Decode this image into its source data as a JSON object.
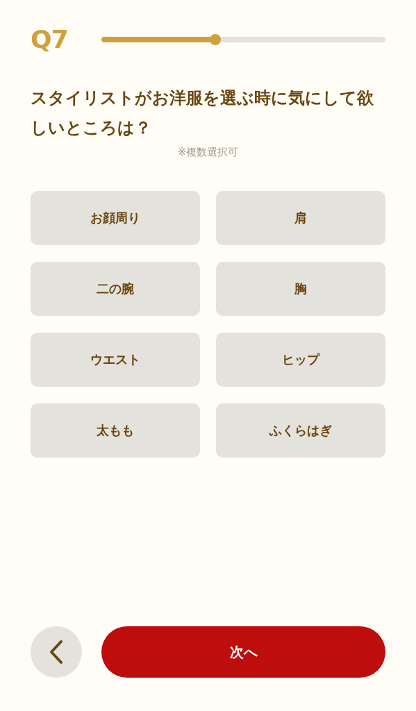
{
  "header": {
    "question_number": "Q7",
    "progress": {
      "level": 0.4
    }
  },
  "question": {
    "title": "スタイリストがお洋服を選ぶ時に気にして欲しいところは？",
    "note": "※複数選択可"
  },
  "options": [
    {
      "label": "お顔周り",
      "selected": false
    },
    {
      "label": "肩",
      "selected": false
    },
    {
      "label": "二の腕",
      "selected": false
    },
    {
      "label": "胸",
      "selected": false
    },
    {
      "label": "ウエスト",
      "selected": false
    },
    {
      "label": "ヒップ",
      "selected": false
    },
    {
      "label": "太もも",
      "selected": false
    },
    {
      "label": "ふくらはぎ",
      "selected": false
    }
  ],
  "footer": {
    "next_button": "次へ"
  }
}
